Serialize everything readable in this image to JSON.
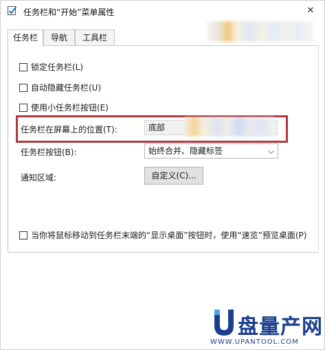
{
  "window": {
    "title": "任务栏和“开始”菜单属性",
    "close_glyph": "✕"
  },
  "tabs": [
    {
      "label": "任务栏",
      "active": true
    },
    {
      "label": "导航",
      "active": false
    },
    {
      "label": "工具栏",
      "active": false
    }
  ],
  "checkboxes": {
    "lock": "锁定任务栏(L)",
    "autohide": "自动隐藏任务栏(U)",
    "small_buttons": "使用小任务栏按钮(E)",
    "peek": "当你将鼠标移动到任务栏末端的“显示桌面”按钮时，使用“速览”预览桌面(P)"
  },
  "position": {
    "label": "任务栏在屏幕上的位置(T):",
    "value": "底部"
  },
  "buttons_setting": {
    "label": "任务栏按钮(B):",
    "value": "始终合并、隐藏标签",
    "chevron": "⌵"
  },
  "notification": {
    "label": "通知区域:",
    "button": "自定义(C)..."
  },
  "watermark": {
    "brand": "盘量产网",
    "url": "WWW.UPANTOOL.COM"
  },
  "colors": {
    "highlight_border": "#b3363c",
    "watermark_blue": "#1b3f8f"
  }
}
